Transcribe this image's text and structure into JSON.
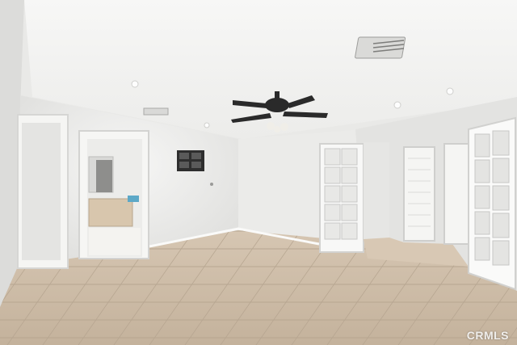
{
  "photo": {
    "watermark": "CRMLS"
  },
  "colors": {
    "ceiling": "#f4f4f3",
    "wall": "#e8e8e6",
    "floor_tile": "#c9b8a3",
    "grout": "#b09f8a",
    "door_white": "#f7f7f6",
    "fan_body": "#2a2a2a"
  }
}
